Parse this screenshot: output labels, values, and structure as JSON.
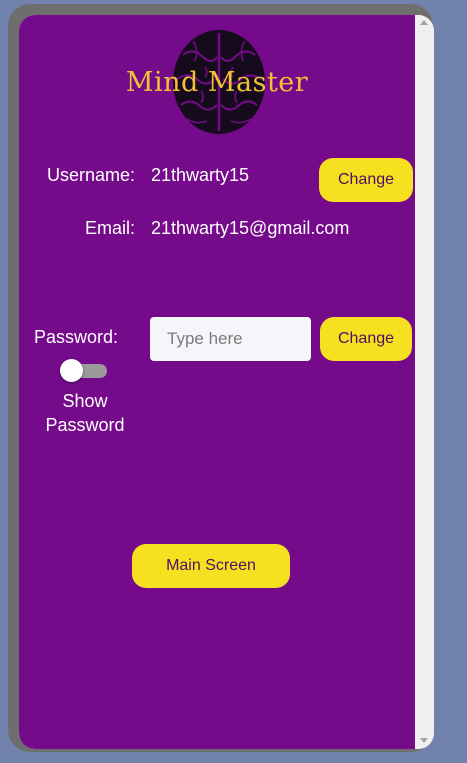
{
  "app": {
    "title": "Mind Master"
  },
  "profile": {
    "username_label": "Username:",
    "username_value": "21thwarty15",
    "username_change_label": "Change",
    "email_label": "Email:",
    "email_value": "21thwarty15@gmail.com",
    "password_label": "Password:",
    "password_placeholder": "Type here",
    "password_value": "",
    "password_change_label": "Change",
    "show_password_label_line1": "Show",
    "show_password_label_line2": "Password",
    "show_password_enabled": false
  },
  "nav": {
    "main_screen_label": "Main Screen"
  },
  "colors": {
    "page_background": "#750b8a",
    "button": "#f7e01f",
    "button_text": "#4d1160",
    "logo_text": "#f2c236",
    "outer_background": "#7183ad",
    "frame": "#6e6e6e"
  },
  "icons": {
    "logo": "brain-icon"
  }
}
